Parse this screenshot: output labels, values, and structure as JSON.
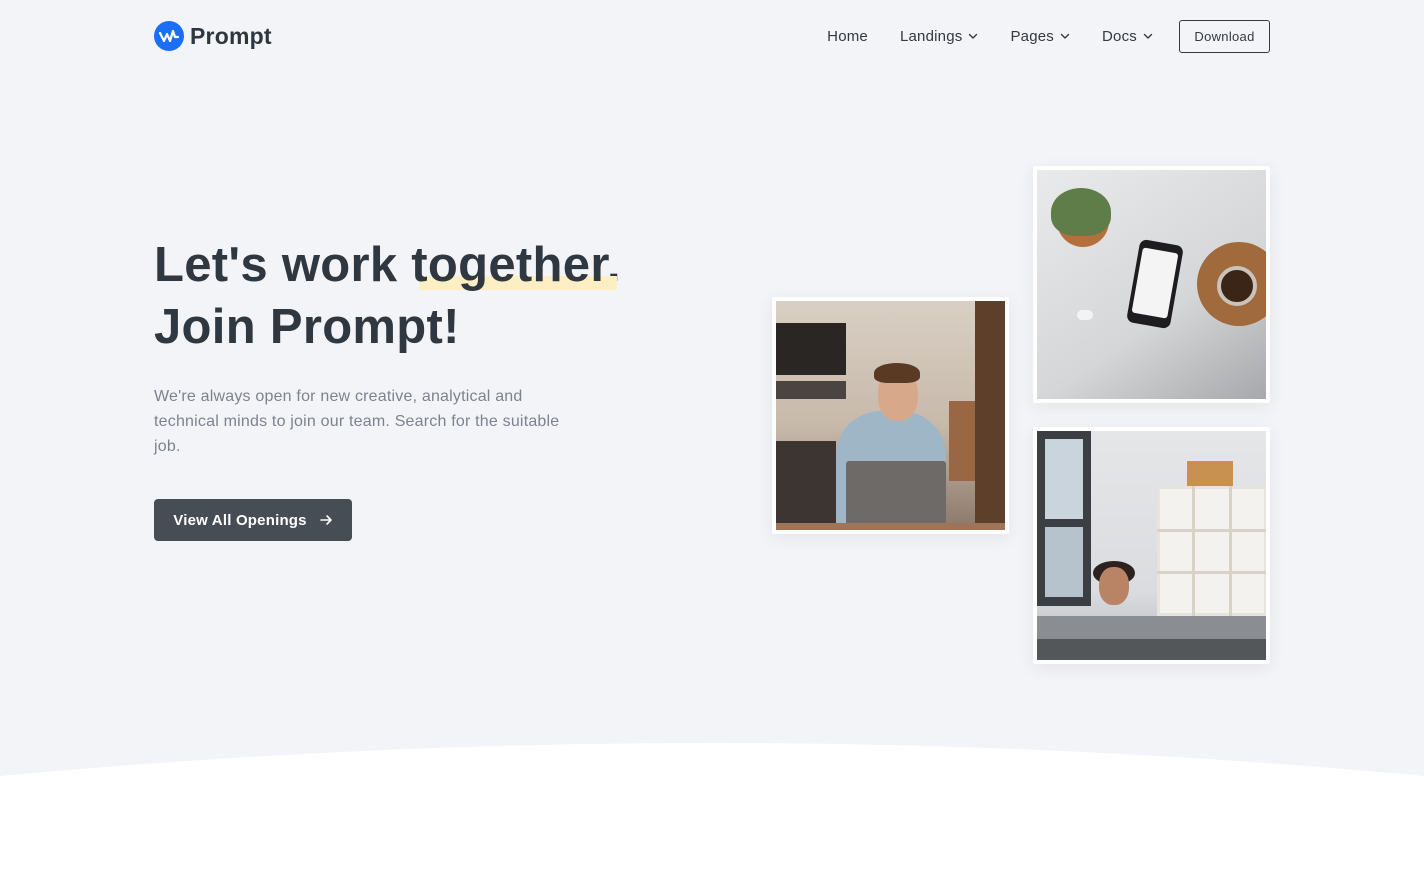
{
  "brand": {
    "name": "Prompt",
    "logo_icon": "wave-logo-icon",
    "logo_color": "#1b6ff5"
  },
  "nav": {
    "items": [
      {
        "label": "Home",
        "has_dropdown": false
      },
      {
        "label": "Landings",
        "has_dropdown": true
      },
      {
        "label": "Pages",
        "has_dropdown": true
      },
      {
        "label": "Docs",
        "has_dropdown": true
      }
    ],
    "download_label": "Download"
  },
  "hero": {
    "title_line1_prefix": "Let's work ",
    "title_highlight": "together",
    "title_line1_suffix": ".",
    "title_line2": "Join Prompt!",
    "subtitle": "We're always open for new creative, analytical and technical minds to join our team. Search for the suitable job.",
    "cta_label": "View All Openings",
    "cta_icon": "arrow-right-icon",
    "highlight_color": "#fdeec3"
  },
  "colors": {
    "background": "#f3f4f7",
    "cta_bg": "#474d55",
    "title": "#2f3740",
    "subtitle": "#7c8390"
  }
}
